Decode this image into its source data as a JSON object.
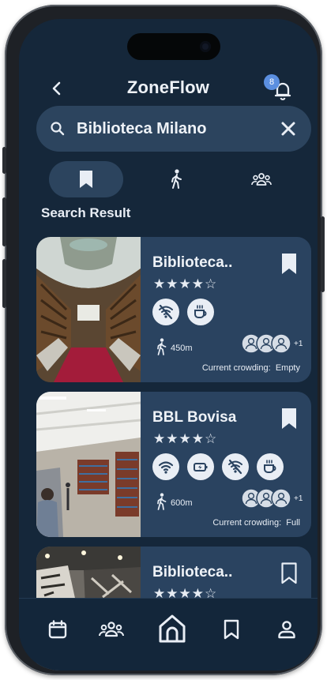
{
  "header": {
    "title": "ZoneFlow",
    "notification_count": "8",
    "icons": {
      "back": "back-icon",
      "bell": "bell-icon"
    }
  },
  "search": {
    "value": "Biblioteca Milano",
    "placeholder": "",
    "icons": {
      "search": "search-icon",
      "clear": "close-icon"
    }
  },
  "tabs": [
    {
      "icon": "bookmark-icon",
      "active": true
    },
    {
      "icon": "walk-icon",
      "active": false
    },
    {
      "icon": "group-icon",
      "active": false
    }
  ],
  "section_label": "Search Result",
  "results": [
    {
      "title": "Biblioteca..",
      "stars": "★★★★☆",
      "rating": 4,
      "bookmarked": true,
      "amenities": [
        "no-wifi-icon",
        "coffee-icon"
      ],
      "distance": "450m",
      "extra_people": "+1",
      "crowding_label": "Current crowding:",
      "crowding_value": "Empty"
    },
    {
      "title": "BBL Bovisa",
      "stars": "★★★★☆",
      "rating": 4,
      "bookmarked": true,
      "amenities": [
        "wifi-icon",
        "charging-icon",
        "no-wifi-icon",
        "coffee-icon"
      ],
      "distance": "600m",
      "extra_people": "+1",
      "crowding_label": "Current crowding:",
      "crowding_value": "Full"
    },
    {
      "title": "Biblioteca..",
      "stars": "★★★★☆",
      "rating": 4,
      "bookmarked": false
    }
  ],
  "bottom_nav": [
    {
      "icon": "calendar-icon"
    },
    {
      "icon": "group-icon"
    },
    {
      "icon": "home-icon",
      "active": true
    },
    {
      "icon": "bookmark-icon"
    },
    {
      "icon": "profile-icon"
    }
  ],
  "colors": {
    "background": "#15273a",
    "card": "#2a4360",
    "search": "#2c445e",
    "badge": "#5b8fe0"
  }
}
